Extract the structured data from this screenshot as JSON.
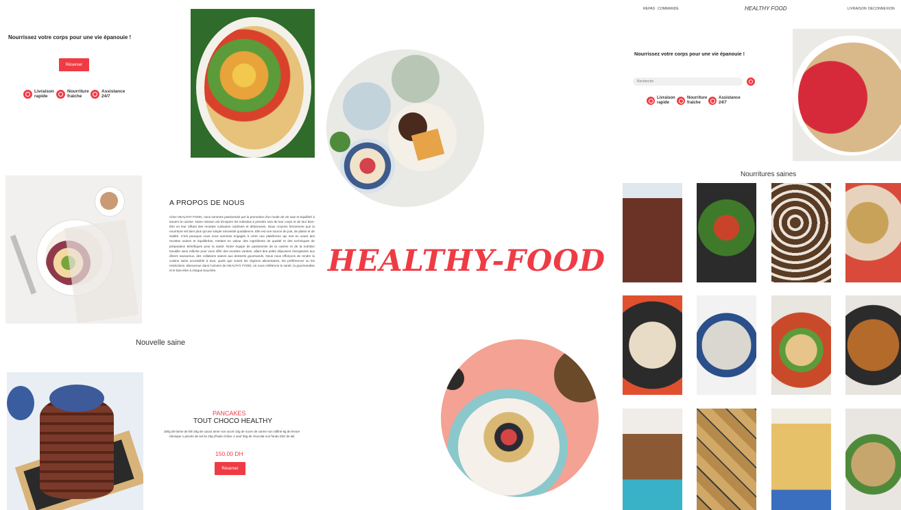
{
  "left_hero": {
    "tagline": "Nourrissez votre corps pour une vie épanouie !",
    "button": "Réserver",
    "features": [
      {
        "icon": "truck-icon",
        "line1": "Livraison",
        "line2": "rapide"
      },
      {
        "icon": "leaf-icon",
        "line1": "Nourriture",
        "line2": "fraîche"
      },
      {
        "icon": "headset-icon",
        "line1": "Assistance",
        "line2": "24/7"
      }
    ]
  },
  "about": {
    "heading": "A PROPOS DE NOUS",
    "body": "Chez HEALTHY FOOD, nous sommes passionnés par la promotion d'un mode de vie sain et équilibré à travers la cuisine. Notre mission est d'inspirer les individus à prendre soin de leur corps et de leur bien-être en leur offrant des recettes culinaires nutritives et délicieuses. Nous croyons fermement que la nourriture est bien plus qu'une simple nécessité quotidienne. Elle est une source de joie, de plaisir et de vitalité. C'est pourquoi nous nous sommes engagés à créer une plateforme qui met en avant des recettes saines et équilibrées, mettant en valeur des ingrédients de qualité et des techniques de préparation bénéfiques pour la santé. Notre équipe de passionnés de la cuisine et de la nutrition travaille sans relâche pour vous offrir des recettes variées, allant des petits déjeuners énergisants aux dîners savoureux, des collations saines aux desserts gourmands. Nous nous efforçons de rendre la cuisine saine accessible à tous, quels que soient les régimes alimentaires, les préférences ou les restrictions. Bienvenue dans l'univers de HEALTHY FOOD, où nous célébrons la santé, la gourmandise et le bien-être à chaque bouchée."
  },
  "brand": {
    "title": "HEALTHY-FOOD"
  },
  "nouvelle": {
    "heading": "Nouvelle saine",
    "category": "PANCAKES",
    "title": "TOUT CHOCO HEALTHY",
    "description": "180g de farine de blé 20g de cacao amer non sucré 10g de sucre de canne non raffiné 8g de levure chimique 1 pincée de sel 5x 20g d'huile d'olive 1 oeuf 30g de chocolat noir fondu 25cl de lait",
    "price": "150.00 DH",
    "button": "Réserver"
  },
  "right_page": {
    "nav_left": [
      "REPAS",
      "COMMANDE"
    ],
    "logo": "HEALTHY FOOD",
    "nav_right": [
      "LIVRAISON",
      "DECONNEXION"
    ],
    "tagline": "Nourrissez votre corps pour une vie épanouie !",
    "search_placeholder": "Recherche",
    "features": [
      {
        "icon": "truck-icon",
        "line1": "Livraison",
        "line2": "rapide"
      },
      {
        "icon": "leaf-icon",
        "line1": "Nourriture",
        "line2": "fraîche"
      },
      {
        "icon": "headset-icon",
        "line1": "Assistance",
        "line2": "24/7"
      }
    ],
    "grid_heading": "Nourritures saines"
  },
  "colors": {
    "accent": "#ef3b44"
  }
}
